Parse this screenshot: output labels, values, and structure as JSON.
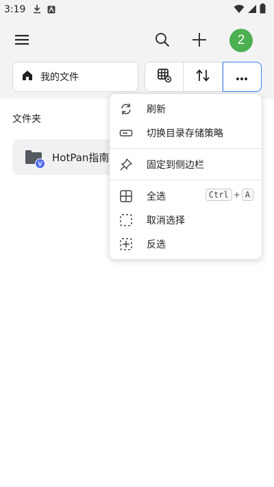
{
  "status_bar": {
    "time": "3:19"
  },
  "app_bar": {
    "avatar_label": "2",
    "avatar_color": "#4caf50"
  },
  "toolbar": {
    "breadcrumb_label": "我的文件"
  },
  "content": {
    "section_title": "文件夹",
    "folders": [
      {
        "name": "HotPan指南",
        "badge": "V"
      }
    ]
  },
  "menu": {
    "items": [
      {
        "label": "刷新",
        "icon": "refresh-icon"
      },
      {
        "label": "切换目录存储策略",
        "icon": "storage-icon"
      },
      {
        "label": "固定到侧边栏",
        "icon": "pin-icon"
      },
      {
        "label": "全选",
        "icon": "select-all-icon",
        "shortcut": [
          "Ctrl",
          "A"
        ]
      },
      {
        "label": "取消选择",
        "icon": "deselect-icon"
      },
      {
        "label": "反选",
        "icon": "invert-selection-icon"
      }
    ]
  },
  "colors": {
    "accent": "#3b82f6",
    "badge": "#4f6bed"
  }
}
